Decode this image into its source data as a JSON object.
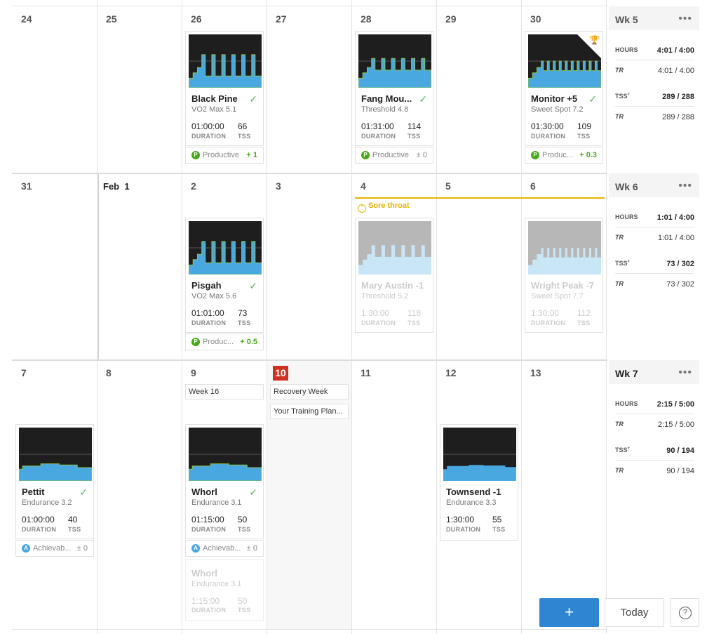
{
  "rows": [
    {
      "days": [
        "24",
        "25",
        "26",
        "27",
        "28",
        "29",
        "30"
      ]
    },
    {
      "days": [
        "31",
        "Feb  1",
        "2",
        "3",
        "4",
        "5",
        "6"
      ]
    },
    {
      "days": [
        "7",
        "8",
        "9",
        "",
        "11",
        "12",
        "13"
      ],
      "today": "10"
    }
  ],
  "workouts": [
    {
      "name": "Black Pine",
      "type": "VO2 Max 5.1",
      "duration": "01:00:00",
      "tss": "66",
      "done": true,
      "progression": {
        "icon": "P",
        "label": "Productive",
        "delta": "+ 1"
      }
    },
    {
      "name": "Fang Mou...",
      "type": "Threshold 4.8",
      "duration": "01:31:00",
      "tss": "114",
      "done": true,
      "progression": {
        "icon": "P",
        "label": "Productive",
        "delta": "± 0"
      }
    },
    {
      "name": "Monitor +5",
      "type": "Sweet Spot 7.2",
      "duration": "01:30:00",
      "tss": "109",
      "done": true,
      "trophy": "trophy-icon",
      "progression": {
        "icon": "P",
        "label": "Produc...",
        "delta": "+ 0.3"
      }
    },
    {
      "name": "Pisgah",
      "type": "VO2 Max 5.6",
      "duration": "01:01:00",
      "tss": "73",
      "done": true,
      "progression": {
        "icon": "P",
        "label": "Produc...",
        "delta": "+ 0.5"
      }
    },
    {
      "name": "Mary Austin -1",
      "type": "Threshold 5.2",
      "duration": "1:30:00",
      "tss": "118",
      "done": false
    },
    {
      "name": "Wright Peak -7",
      "type": "Sweet Spot 7.7",
      "duration": "1:30:00",
      "tss": "112",
      "done": false
    },
    {
      "name": "Pettit",
      "type": "Endurance 3.2",
      "duration": "01:00:00",
      "tss": "40",
      "done": true,
      "progression": {
        "icon": "A",
        "label": "Achievab...",
        "delta": "± 0"
      }
    },
    {
      "name": "Whorl",
      "type": "Endurance 3.1",
      "duration": "01:15:00",
      "tss": "50",
      "done": true,
      "progression": {
        "icon": "A",
        "label": "Achievab...",
        "delta": "± 0"
      }
    },
    {
      "name": "Whorl",
      "type": "Endurance 3.1",
      "duration": "1:15:00",
      "tss": "50",
      "done": false
    },
    {
      "name": "Townsend -1",
      "type": "Endurance 3.3",
      "duration": "1:30:00",
      "tss": "55",
      "done": false
    }
  ],
  "labels": {
    "duration": "DURATION",
    "tss": "TSS",
    "check": "✓",
    "trophy": "🏆",
    "more": "•••"
  },
  "illness": {
    "label": "Sore throat",
    "icon": "sick-face-icon"
  },
  "notes": {
    "week16": "Week 16",
    "recovery": "Recovery Week",
    "plan": "Your Training Plan..."
  },
  "weeks": [
    {
      "title": "Wk 5",
      "hours": "4:01 / 4:00",
      "hours_tr": "4:01 / 4:00",
      "tss": "289 / 288",
      "tss_tr": "289 / 288"
    },
    {
      "title": "Wk 6",
      "hours": "1:01 / 4:00",
      "hours_tr": "1:01 / 4:00",
      "tss": "73 / 302",
      "tss_tr": "73 / 302"
    },
    {
      "title": "Wk 7",
      "hours": "2:15 / 5:00",
      "hours_tr": "2:15 / 5:00",
      "tss": "90 / 194",
      "tss_tr": "90 / 194"
    }
  ],
  "week_labels": {
    "hours": "HOURS",
    "tss": "TSS",
    "tss_sup": "+",
    "tr": "TR"
  },
  "buttons": {
    "add": "+",
    "today": "Today",
    "help": "?"
  },
  "colors": {
    "power_fill": "#4aa8e0",
    "power_line": "#8bc34a",
    "today_red": "#d0301f",
    "illness": "#e8b400",
    "productive": "#49a81b",
    "achievable": "#4aa8e0",
    "primary": "#2e86d3"
  }
}
